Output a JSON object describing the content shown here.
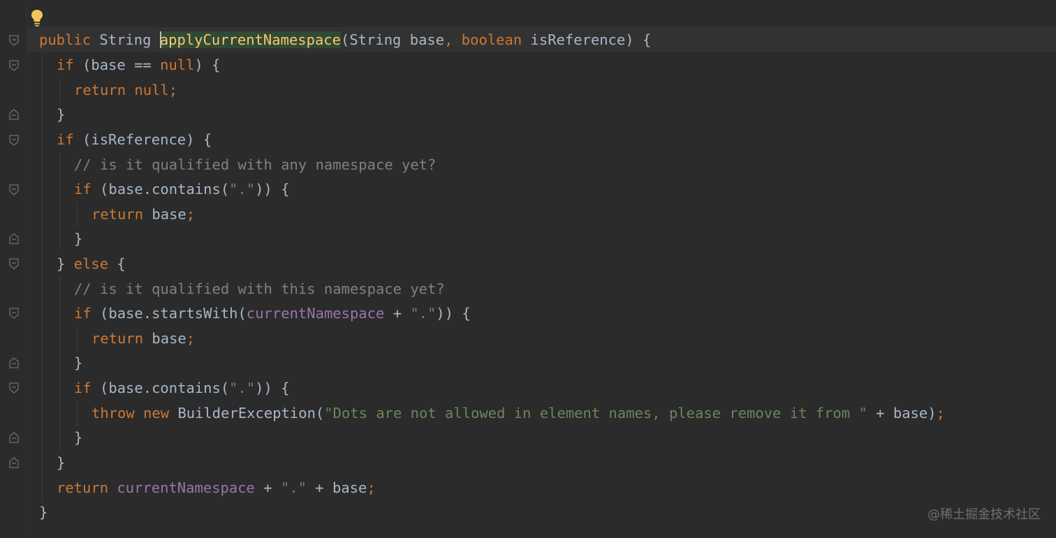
{
  "colors": {
    "background": "#2b2b2b",
    "keyword": "#cc7832",
    "method": "#ffc66d",
    "string": "#6a8759",
    "comment": "#808080",
    "field": "#9876aa",
    "default": "#a9b7c6"
  },
  "icons": {
    "intention": "lightbulb-icon",
    "fold": "fold-marker-icon"
  },
  "code": {
    "l1": {
      "kw_public": "public",
      "type_string": "String",
      "method_name": "applyCurrentNamespace",
      "params_open": "(String base",
      "comma": ",",
      "kw_boolean": "boolean",
      "param_isref": "isReference) {"
    },
    "l2": {
      "kw_if": "if",
      "cond_open": "(base ==",
      "kw_null": "null",
      "close": ") {"
    },
    "l3": {
      "kw_return": "return",
      "kw_null": "null;"
    },
    "l4": {
      "brace": "}"
    },
    "l5": {
      "kw_if": "if",
      "cond": "(isReference) {"
    },
    "l6": {
      "comment": "// is it qualified with any namespace yet?"
    },
    "l7": {
      "kw_if": "if",
      "call": "(base.contains(",
      "str_dot": "\".\"",
      "close": ")) {"
    },
    "l8": {
      "kw_return": "return",
      "ident": "base",
      "semi": ";"
    },
    "l9": {
      "brace": "}"
    },
    "l10": {
      "brace": "}",
      "kw_else": "else",
      "open": "{"
    },
    "l11": {
      "comment": "// is it qualified with this namespace yet?"
    },
    "l12": {
      "kw_if": "if",
      "call": "(base.startsWith(",
      "field": "currentNamespace",
      "plus": "+",
      "str_dot": "\".\"",
      "close": ")) {"
    },
    "l13": {
      "kw_return": "return",
      "ident": "base",
      "semi": ";"
    },
    "l14": {
      "brace": "}"
    },
    "l15": {
      "kw_if": "if",
      "call": "(base.contains(",
      "str_dot": "\".\"",
      "close": ")) {"
    },
    "l16": {
      "kw_throw": "throw",
      "kw_new": "new",
      "ctor": "BuilderException(",
      "str_msg": "\"Dots are not allowed in element names, please remove it from \"",
      "plus_base": "+ base)",
      "semi": ";"
    },
    "l17": {
      "brace": "}"
    },
    "l18": {
      "brace": "}"
    },
    "l19": {
      "kw_return": "return",
      "field": "currentNamespace",
      "plus1": "+",
      "str_dot": "\".\"",
      "plus2": "+ base",
      "semi": ";"
    },
    "l20": {
      "brace": "}"
    }
  },
  "watermark": "@稀土掘金技术社区"
}
